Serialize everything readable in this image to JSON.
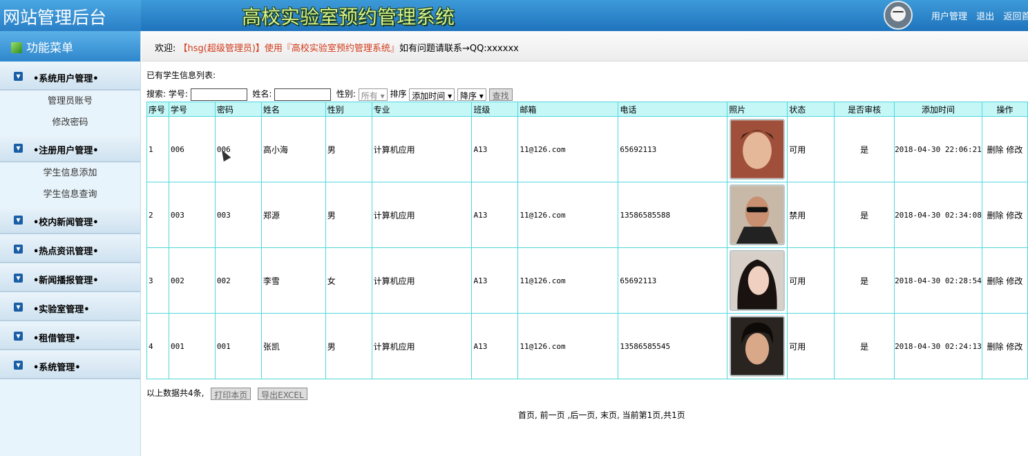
{
  "header": {
    "admin_title": "网站管理后台",
    "system_title": "高校实验室预约管理系统",
    "links": [
      "用户管理",
      "退出",
      "返回首页"
    ]
  },
  "sidebar": {
    "title": "功能菜单",
    "groups": [
      {
        "label": "•系统用户管理•",
        "items": [
          "管理员账号",
          "修改密码"
        ]
      },
      {
        "label": "•注册用户管理•",
        "items": [
          "学生信息添加",
          "学生信息查询"
        ]
      },
      {
        "label": "•校内新闻管理•",
        "items": []
      },
      {
        "label": "•热点资讯管理•",
        "items": []
      },
      {
        "label": "•新闻播报管理•",
        "items": []
      },
      {
        "label": "•实验室管理•",
        "items": []
      },
      {
        "label": "•租借管理•",
        "items": []
      },
      {
        "label": "•系统管理•",
        "items": []
      }
    ]
  },
  "welcome": {
    "prefix": "欢迎: ",
    "highlight": "【hsg(超级管理员)】使用『高校实验室预约管理系统』",
    "suffix": "如有问题请联系→QQ:xxxxxx"
  },
  "list": {
    "title": "已有学生信息列表:",
    "search": {
      "label": "搜索:",
      "student_id_label": "学号:",
      "student_id_value": "",
      "name_label": "姓名:",
      "name_value": "",
      "gender_label": "性别:",
      "gender_value": "所有 ▾",
      "sort_label": "排序",
      "sort_field": "添加时间 ▾",
      "sort_order": "降序 ▾",
      "search_button": "查找"
    },
    "columns": [
      "序号",
      "学号",
      "密码",
      "姓名",
      "性别",
      "专业",
      "班级",
      "邮箱",
      "电话",
      "照片",
      "状态",
      "是否审核",
      "添加时间",
      "操作"
    ],
    "rows": [
      {
        "no": "1",
        "sid": "006",
        "pwd": "006",
        "name": "高小海",
        "gender": "男",
        "major": "计算机应用",
        "cls": "A13",
        "email": "11@126.com",
        "phone": "65692113",
        "status": "可用",
        "audit": "是",
        "time": "2018-04-30 22:06:21",
        "del": "删除",
        "edit": "修改"
      },
      {
        "no": "2",
        "sid": "003",
        "pwd": "003",
        "name": "郑源",
        "gender": "男",
        "major": "计算机应用",
        "cls": "A13",
        "email": "11@126.com",
        "phone": "13586585588",
        "status": "禁用",
        "audit": "是",
        "time": "2018-04-30 02:34:08",
        "del": "删除",
        "edit": "修改"
      },
      {
        "no": "3",
        "sid": "002",
        "pwd": "002",
        "name": "李雪",
        "gender": "女",
        "major": "计算机应用",
        "cls": "A13",
        "email": "11@126.com",
        "phone": "65692113",
        "status": "可用",
        "audit": "是",
        "time": "2018-04-30 02:28:54",
        "del": "删除",
        "edit": "修改"
      },
      {
        "no": "4",
        "sid": "001",
        "pwd": "001",
        "name": "张凯",
        "gender": "男",
        "major": "计算机应用",
        "cls": "A13",
        "email": "11@126.com",
        "phone": "13586585545",
        "status": "可用",
        "audit": "是",
        "time": "2018-04-30 02:24:13",
        "del": "删除",
        "edit": "修改"
      }
    ],
    "summary": "以上数据共4条,",
    "print_button": "打印本页",
    "export_button": "导出EXCEL",
    "pager": {
      "first": "首页,",
      "prev": "前一页",
      "next": ",后一页,",
      "last": "末页,",
      "info": "当前第1页,共1页"
    }
  }
}
